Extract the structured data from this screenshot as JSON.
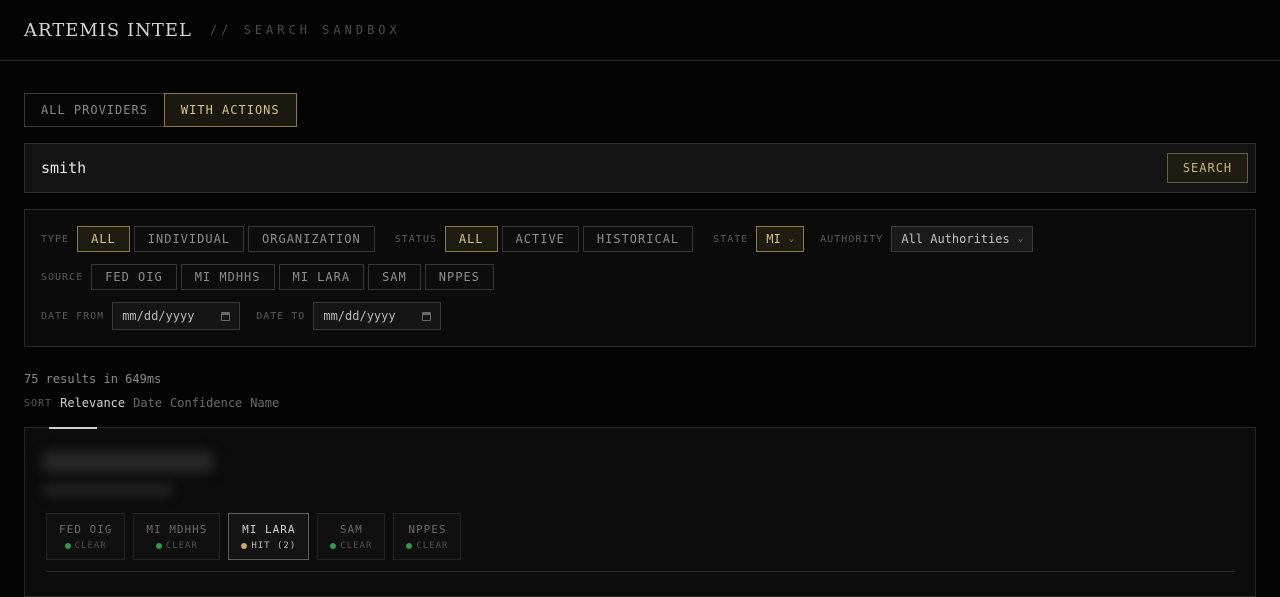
{
  "header": {
    "brand": "ARTEMIS INTEL",
    "subtitle": "// SEARCH SANDBOX"
  },
  "tabs": [
    {
      "label": "ALL PROVIDERS",
      "active": false
    },
    {
      "label": "WITH ACTIONS",
      "active": true
    }
  ],
  "search": {
    "value": "smith",
    "button": "SEARCH"
  },
  "filters": {
    "type": {
      "label": "TYPE",
      "options": [
        "ALL",
        "INDIVIDUAL",
        "ORGANIZATION"
      ],
      "selected": "ALL"
    },
    "status": {
      "label": "STATUS",
      "options": [
        "ALL",
        "ACTIVE",
        "HISTORICAL"
      ],
      "selected": "ALL"
    },
    "state": {
      "label": "STATE",
      "value": "MI"
    },
    "authority": {
      "label": "AUTHORITY",
      "value": "All Authorities"
    },
    "source": {
      "label": "SOURCE",
      "options": [
        "FED OIG",
        "MI MDHHS",
        "MI LARA",
        "SAM",
        "NPPES"
      ]
    },
    "date_from": {
      "label": "DATE FROM",
      "placeholder": "mm/dd/yyyy"
    },
    "date_to": {
      "label": "DATE TO",
      "placeholder": "mm/dd/yyyy"
    }
  },
  "results": {
    "summary": "75 results in 649ms"
  },
  "sort": {
    "label": "SORT",
    "options": [
      "Relevance",
      "Date",
      "Confidence",
      "Name"
    ],
    "selected": "Relevance"
  },
  "result_card": {
    "sources": [
      {
        "name": "FED OIG",
        "status": "CLEAR",
        "hit": false
      },
      {
        "name": "MI MDHHS",
        "status": "CLEAR",
        "hit": false
      },
      {
        "name": "MI LARA",
        "status": "HIT (2)",
        "hit": true
      },
      {
        "name": "SAM",
        "status": "CLEAR",
        "hit": false
      },
      {
        "name": "NPPES",
        "status": "CLEAR",
        "hit": false
      }
    ]
  },
  "colors": {
    "accent_gold": "#d5c48c",
    "clear_green": "#2f9a48",
    "hit_gold": "#c9a86a"
  }
}
